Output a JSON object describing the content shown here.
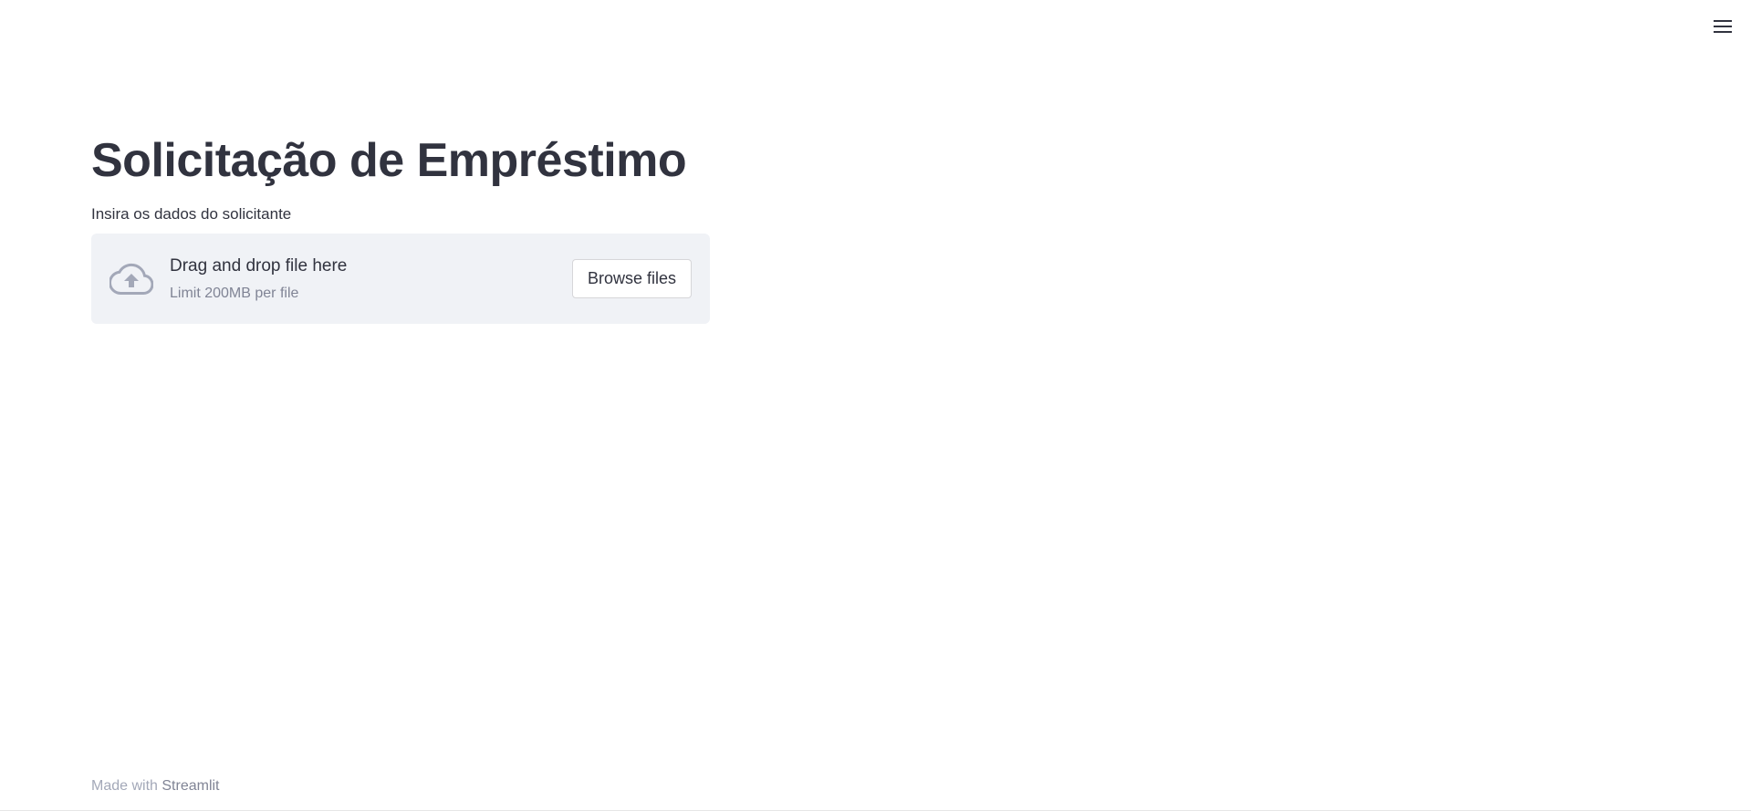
{
  "header": {
    "menu_icon": "hamburger-menu-icon"
  },
  "main": {
    "title": "Solicitação de Empréstimo",
    "uploader": {
      "label": "Insira os dados do solicitante",
      "icon": "cloud-upload-icon",
      "primary_text": "Drag and drop file here",
      "secondary_text": "Limit 200MB per file",
      "browse_label": "Browse files"
    }
  },
  "footer": {
    "prefix": "Made with",
    "link": "Streamlit"
  },
  "colors": {
    "text": "#31333f",
    "dropzone_bg": "#f0f2f6",
    "icon": "#a3a8b8",
    "muted": "#808495"
  }
}
